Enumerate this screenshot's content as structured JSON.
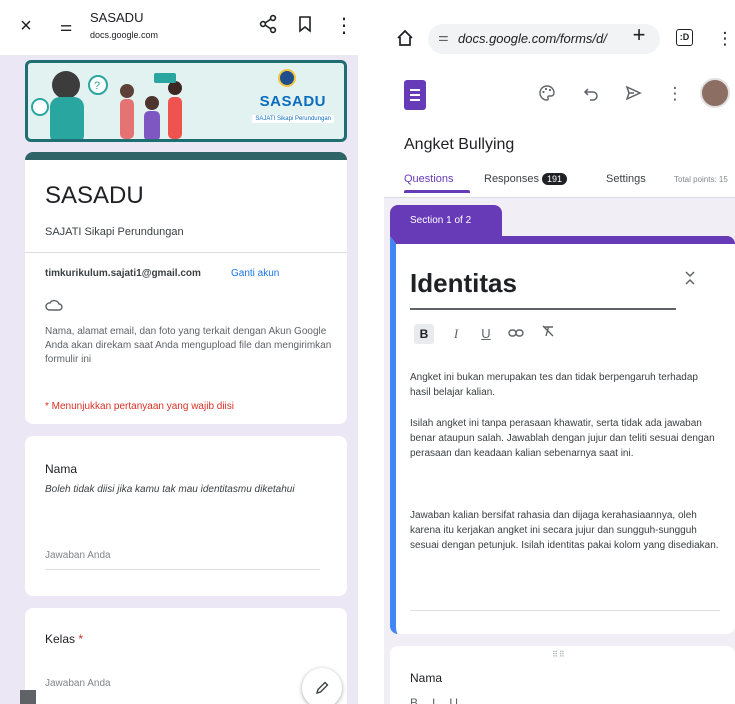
{
  "left": {
    "header": {
      "close_icon": "×",
      "title": "SASADU",
      "domain": "docs.google.com",
      "share_icon": "share-icon",
      "bookmark_icon": "bookmark-icon",
      "more_icon": "⋮"
    },
    "banner": {
      "brand": "SASADU",
      "brand_sub": "SAJATI Sikapi Perundungan"
    },
    "form_header": {
      "title": "SASADU",
      "description": "SAJATI Sikapi Perundungan",
      "email": "timkurikulum.sajati1@gmail.com",
      "switch_account": "Ganti akun",
      "notice": "Nama, alamat email, dan foto yang terkait dengan Akun Google Anda akan direkam saat Anda mengupload file dan mengirimkan formulir ini",
      "required_note": "* Menunjukkan pertanyaan yang wajib diisi"
    },
    "questions": [
      {
        "label": "Nama",
        "hint": "Boleh tidak diisi jika kamu tak mau identitasmu diketahui",
        "placeholder": "Jawaban Anda"
      },
      {
        "label": "Kelas",
        "required_mark": "*",
        "placeholder": "Jawaban Anda"
      }
    ]
  },
  "right": {
    "browser": {
      "url": "docs.google.com/forms/d/",
      "tab_count": ":D"
    },
    "app": {
      "form_title": "Angket Bullying",
      "tabs": [
        {
          "label": "Questions"
        },
        {
          "label": "Responses",
          "badge": "191"
        },
        {
          "label": "Settings"
        }
      ],
      "total_points": "Total points: 15"
    },
    "section": {
      "tag": "Section 1 of 2",
      "title": "Identitas",
      "paragraphs": [
        "Angket ini bukan merupakan tes dan tidak berpengaruh terhadap hasil belajar kalian.",
        "Isilah angket ini tanpa perasaan khawatir, serta tidak ada jawaban benar ataupun salah. Jawablah dengan jujur dan teliti sesuai dengan perasaan dan keadaan kalian sebenarnya saat ini.",
        "Jawaban kalian bersifat rahasia dan dijaga kerahasiaannya, oleh karena itu kerjakan angket ini secara jujur dan sungguh-sungguh sesuai dengan petunjuk. Isilah identitas pakai kolom yang disediakan."
      ]
    },
    "question": {
      "label": "Nama"
    }
  }
}
